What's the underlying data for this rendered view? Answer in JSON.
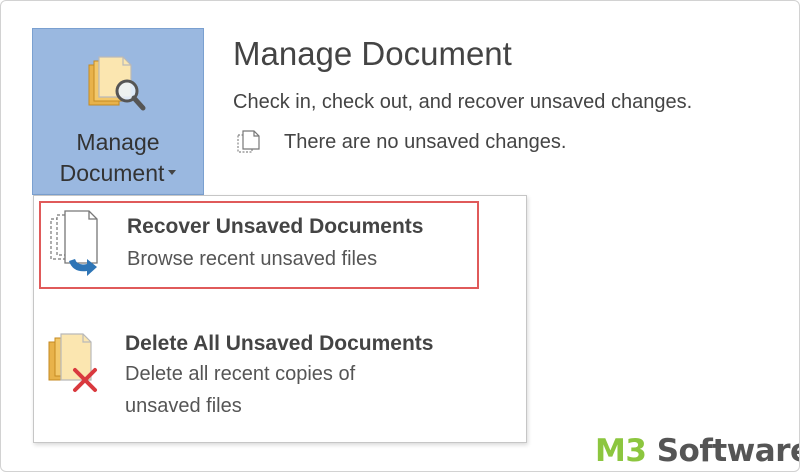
{
  "manage_button": {
    "line1": "Manage",
    "line2": "Document",
    "icon": "manage-document-icon",
    "color": "#9ab8e0"
  },
  "header": {
    "title": "Manage Document",
    "description": "Check in, check out, and recover unsaved changes.",
    "status": "There are no unsaved changes.",
    "status_icon": "document-outline-icon"
  },
  "menu": {
    "items": [
      {
        "title": "Recover Unsaved Documents",
        "subtitle": "Browse recent unsaved files",
        "icon": "recover-documents-icon",
        "highlight_color": "#e05a5a"
      },
      {
        "title": "Delete All Unsaved Documents",
        "subtitle_line1": "Delete all recent copies of",
        "subtitle_line2": "unsaved files",
        "icon": "delete-documents-icon"
      }
    ]
  },
  "watermark": {
    "part1": "M3",
    "part2": " Software",
    "colors": {
      "m3": "#8cc63f",
      "software": "#555555"
    }
  }
}
